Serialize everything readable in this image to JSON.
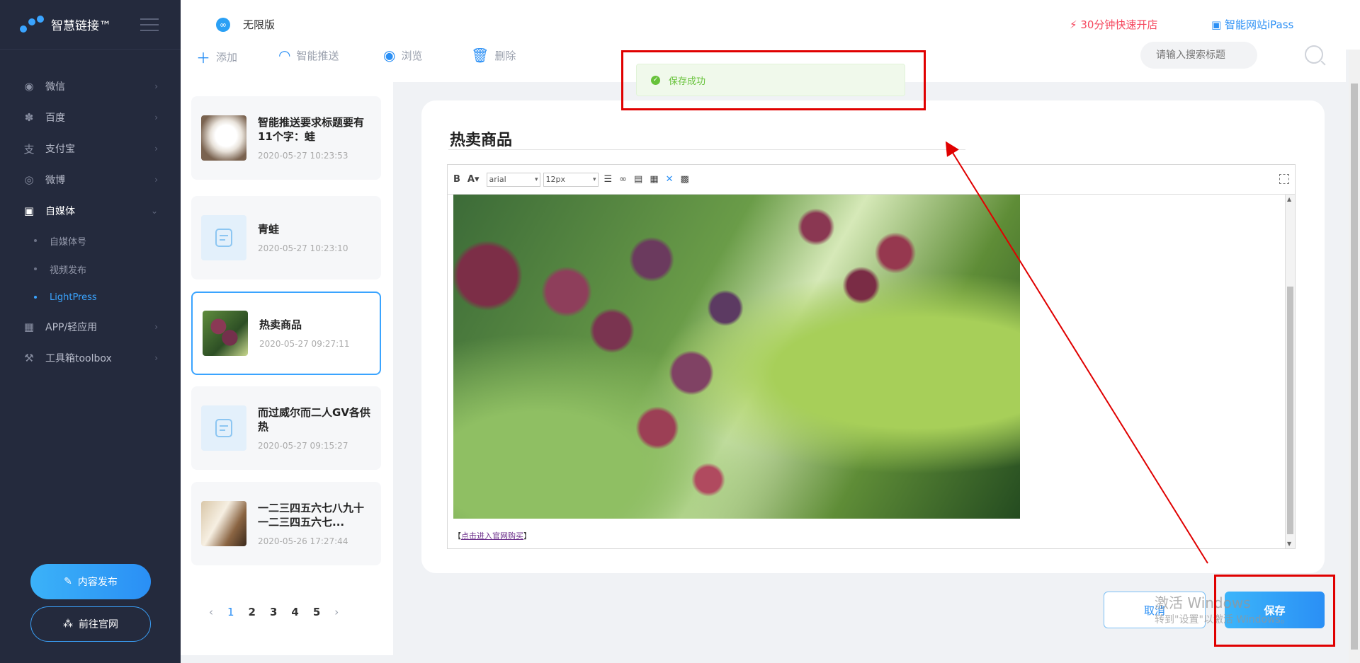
{
  "sidebar": {
    "brand": "智慧链接™",
    "menu": [
      {
        "label": "微信",
        "icon": "wechat-icon"
      },
      {
        "label": "百度",
        "icon": "paw-icon"
      },
      {
        "label": "支付宝",
        "icon": "alipay-icon"
      },
      {
        "label": "微博",
        "icon": "weibo-icon"
      },
      {
        "label": "自媒体",
        "icon": "camera-icon"
      }
    ],
    "submenu": [
      {
        "label": "自媒体号"
      },
      {
        "label": "视频发布"
      },
      {
        "label": "LightPress"
      }
    ],
    "menu_bottom": [
      {
        "label": "APP/轻应用",
        "icon": "app-grid-icon"
      },
      {
        "label": "工具箱toolbox",
        "icon": "wrench-icon"
      }
    ],
    "publish_button": "内容发布",
    "website_button": "前往官网"
  },
  "topbar": {
    "edition": "无限版",
    "quick_store": "30分钟快速开店",
    "ipass": "智能网站iPass"
  },
  "toolbar": {
    "add": "添加",
    "push": "智能推送",
    "browse": "浏览",
    "delete": "删除",
    "search_placeholder": "请输入搜索标题"
  },
  "articles": [
    {
      "title": "智能推送要求标题要有11个字：蛙",
      "date": "2020-05-27 10:23:53",
      "thumb": "bunny"
    },
    {
      "title": "青蛙",
      "date": "2020-05-27 10:23:10",
      "thumb": "doc"
    },
    {
      "title": "热卖商品",
      "date": "2020-05-27 09:27:11",
      "thumb": "grape"
    },
    {
      "title": "而过威尔而二人GV各供热",
      "date": "2020-05-27 09:15:27",
      "thumb": "doc"
    },
    {
      "title": "一二三四五六七八九十一二三四五六七...",
      "date": "2020-05-26 17:27:44",
      "thumb": "book"
    }
  ],
  "pagination": {
    "pages": [
      "1",
      "2",
      "3",
      "4",
      "5"
    ],
    "current": "1",
    "prev": "‹",
    "next": "›"
  },
  "editor": {
    "title": "热卖商品",
    "font": "arial",
    "size": "12px",
    "link_prefix": "【",
    "link_text": "点击进入官网购买",
    "link_suffix": "】"
  },
  "actions": {
    "cancel": "取消",
    "save": "保存"
  },
  "toast": {
    "message": "保存成功"
  },
  "watermark": {
    "line1": "激活 Windows",
    "line2": "转到\"设置\"以激活 Windows。"
  }
}
